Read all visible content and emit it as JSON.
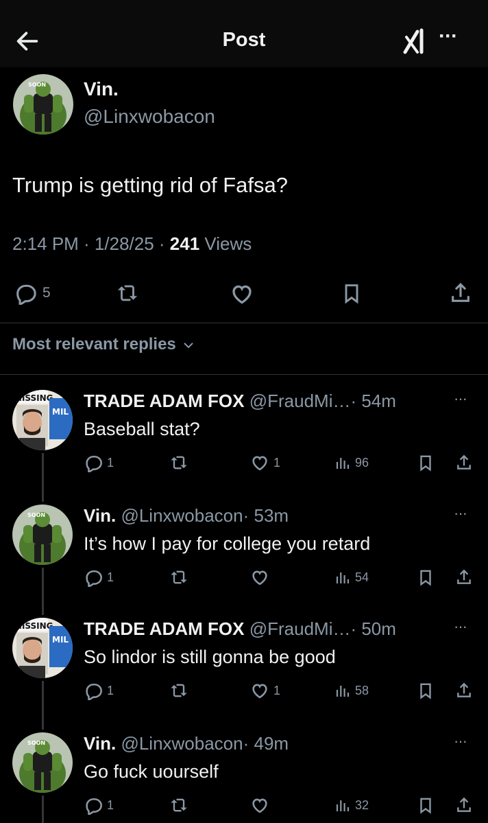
{
  "header": {
    "title": "Post",
    "back_icon": "arrow-left-icon",
    "grok_icon": "grok-icon",
    "more_icon": "more-icon",
    "more_label": "···"
  },
  "post": {
    "author_name": "Vin.",
    "author_handle": "@Linxwobacon",
    "text": "Trump is getting rid of Fafsa?",
    "time": "2:14 PM · 1/28/25 · ",
    "views_count": "241",
    "views_label": " Views",
    "reply_count": "5"
  },
  "replies_sort": {
    "label": "Most relevant replies"
  },
  "replies": [
    {
      "name": "TRADE ADAM FOX",
      "handle": "@FraudMi…",
      "time": "· 54m",
      "text": "Baseball stat?",
      "replies": "1",
      "likes": "1",
      "views": "96",
      "avatar": "missing-poster"
    },
    {
      "name": "Vin.",
      "handle": "@Linxwobacon",
      "time": "· 53m",
      "text": "It’s how I pay for college you retard",
      "replies": "1",
      "likes": "",
      "views": "54",
      "avatar": "hulk"
    },
    {
      "name": "TRADE ADAM FOX",
      "handle": "@FraudMi…",
      "time": "· 50m",
      "text": "So lindor is still gonna be good",
      "replies": "1",
      "likes": "1",
      "views": "58",
      "avatar": "missing-poster"
    },
    {
      "name": "Vin.",
      "handle": "@Linxwobacon",
      "time": "· 49m",
      "text": "Go fuck uourself",
      "replies": "1",
      "likes": "",
      "views": "32",
      "avatar": "hulk"
    }
  ],
  "colors": {
    "background": "#000000",
    "text": "#e7e9ea",
    "muted": "#8b98a5",
    "hulk_green": "#4e7a2e"
  }
}
